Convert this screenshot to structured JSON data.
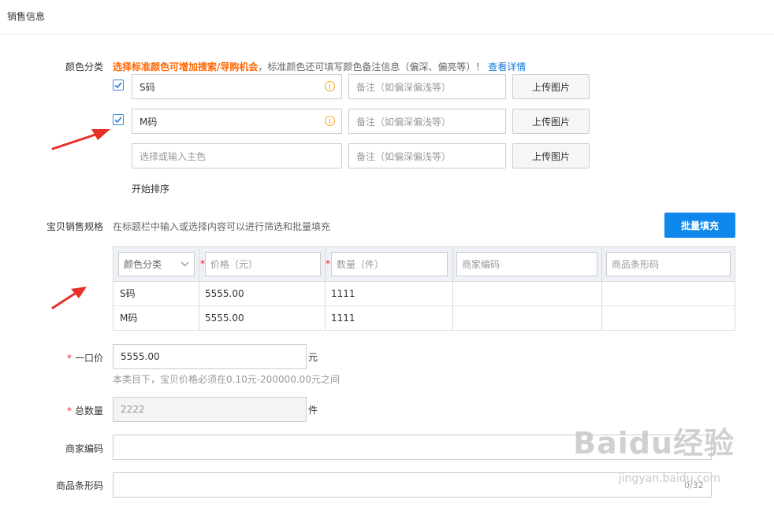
{
  "section": {
    "title": "销售信息"
  },
  "color": {
    "label": "颜色分类",
    "tip_highlight": "选择标准颜色可增加搜索/导购机会",
    "tip_text": "，标准颜色还可填写颜色备注信息（偏深、偏亮等）！",
    "tip_link": "查看详情",
    "rows": [
      {
        "checked": true,
        "value": "S码",
        "note_placeholder": "备注（如偏深偏浅等）",
        "upload": "上传图片"
      },
      {
        "checked": true,
        "value": "M码",
        "note_placeholder": "备注（如偏深偏浅等）",
        "upload": "上传图片"
      },
      {
        "checked": false,
        "placeholder": "选择或输入主色",
        "note_placeholder": "备注（如偏深偏浅等）",
        "upload": "上传图片"
      }
    ],
    "sort_label": "开始排序"
  },
  "spec": {
    "label": "宝贝销售规格",
    "hint": "在标题栏中输入或选择内容可以进行筛选和批量填充",
    "batch_button": "批量填充",
    "headers": [
      "颜色分类",
      "价格（元）",
      "数量（件）",
      "商家编码",
      "商品条形码"
    ],
    "rows": [
      {
        "color": "S码",
        "price": "5555.00",
        "qty": "1111",
        "code": "",
        "barcode": ""
      },
      {
        "color": "M码",
        "price": "5555.00",
        "qty": "1111",
        "code": "",
        "barcode": ""
      }
    ]
  },
  "price": {
    "required": "*",
    "label": "一口价",
    "value": "5555.00",
    "unit": "元",
    "hint": "本类目下，宝贝价格必须在0.10元-200000.00元之间"
  },
  "total": {
    "required": "*",
    "label": "总数量",
    "value": "2222",
    "unit": "件"
  },
  "merchant_code": {
    "label": "商家编码",
    "value": ""
  },
  "barcode": {
    "label": "商品条形码",
    "value": "",
    "counter": "0/32"
  },
  "watermark": {
    "brand": "Baidu经验",
    "url": "jingyan.baidu.com"
  },
  "colors": {
    "accent": "#0f88eb",
    "orange": "#ff6600",
    "required": "#f5222d",
    "warn": "#f5a623",
    "arrow": "#e8302a"
  }
}
